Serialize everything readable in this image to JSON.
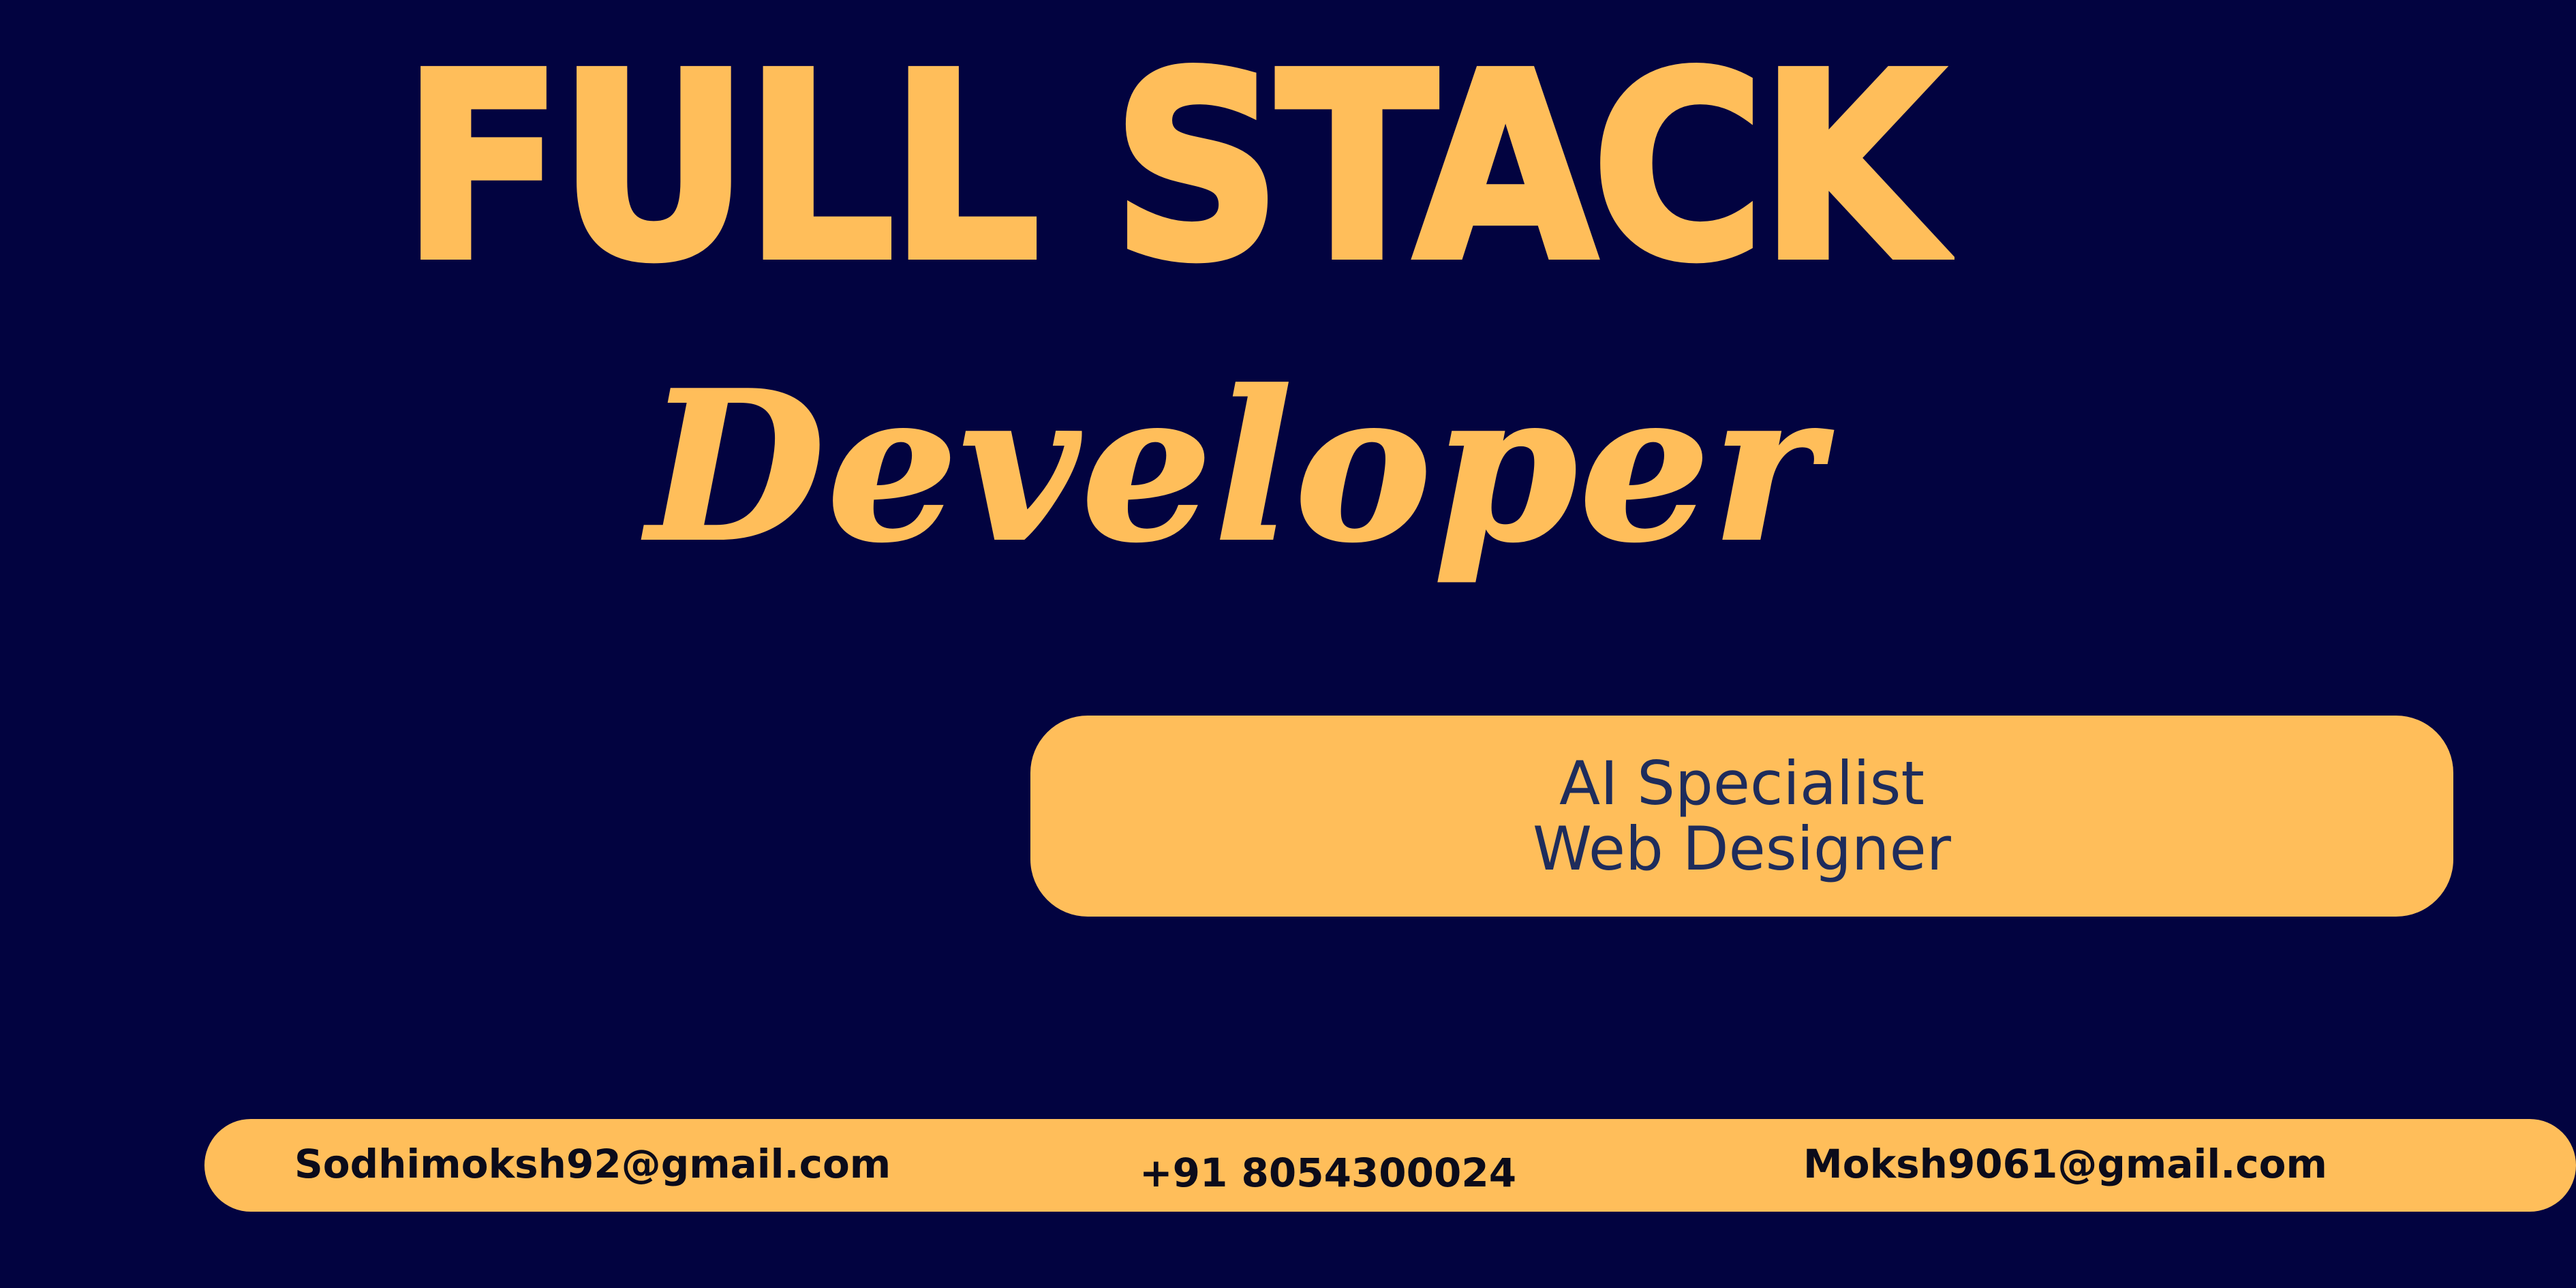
{
  "headline": "FULL STACK",
  "subtitle": "Developer",
  "roles": [
    "AI Specialist",
    "Web Designer"
  ],
  "contacts": {
    "email_primary": "Sodhimoksh92@gmail.com",
    "phone": "+91 8054300024",
    "email_secondary": "Moksh9061@gmail.com"
  },
  "colors": {
    "background": "#020340",
    "accent": "#FFBE5A",
    "role_text": "#1E2C5C",
    "contact_text": "#0B0B1A"
  }
}
